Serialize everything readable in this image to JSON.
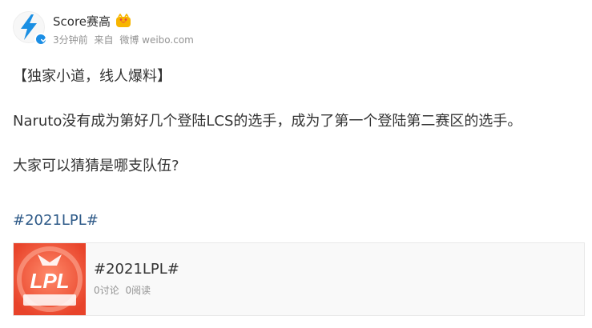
{
  "post": {
    "author": {
      "name": "Score赛高",
      "avatar_icon": "lightning-bolt-icon",
      "verified_icon": "verified-check-icon",
      "member_badge_icon": "member-crown-icon"
    },
    "meta": {
      "time": "3分钟前",
      "source_prefix": "来自",
      "source": "微博 weibo.com"
    },
    "paragraphs": [
      "【独家小道，线人爆料】",
      "Naruto没有成为第好几个登陆LCS的选手，成为了第一个登陆第二赛区的选手。",
      "大家可以猜猜是哪支队伍?"
    ],
    "hashtag": "#2021LPL#"
  },
  "topic_card": {
    "title": "#2021LPL#",
    "discussions": "0讨论",
    "reads": "0阅读",
    "thumbnail_logo_text": "LPL",
    "colors": {
      "thumbnail_bg": "#f25a3a",
      "link": "#2e5a88",
      "verified": "#1b8ee5"
    }
  }
}
